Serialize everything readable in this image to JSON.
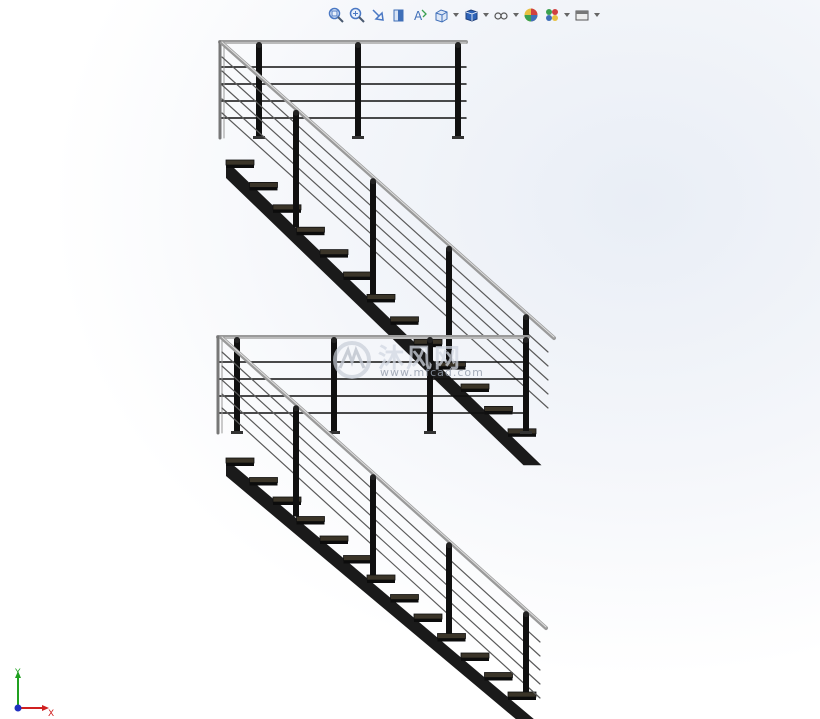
{
  "toolbar": {
    "tools": [
      {
        "name": "zoom-to-fit-icon",
        "color": "#4a78c4"
      },
      {
        "name": "zoom-to-area-icon",
        "color": "#4a78c4"
      },
      {
        "name": "previous-view-icon",
        "color": "#4a78c4"
      },
      {
        "name": "section-view-icon",
        "color": "#3f6fb8"
      },
      {
        "name": "dynamic-annotation-icon",
        "color": "#3f6fb8"
      },
      {
        "name": "view-orientation-icon",
        "color": "#3f6fb8"
      },
      {
        "name": "display-style-icon",
        "color": "#2f64b8"
      },
      {
        "name": "hide-show-items-icon",
        "color": "#555555"
      },
      {
        "name": "edit-appearance-icon",
        "color": "#d04040"
      },
      {
        "name": "apply-scene-icon",
        "color": "#3aa050"
      },
      {
        "name": "view-settings-icon",
        "color": "#555555"
      }
    ]
  },
  "watermark": {
    "text": "沐风网",
    "url": "www.mfcad.com"
  },
  "triad": {
    "x_label": "X",
    "y_label": "Y",
    "x_color": "#d02020",
    "y_color": "#20a020",
    "origin_color": "#2030c0"
  },
  "colors": {
    "stringer": "#1a1a1a",
    "tread": "#3a3428",
    "post": "#101010",
    "rail": "#9a9a9a",
    "cable": "#5a5a5a"
  }
}
